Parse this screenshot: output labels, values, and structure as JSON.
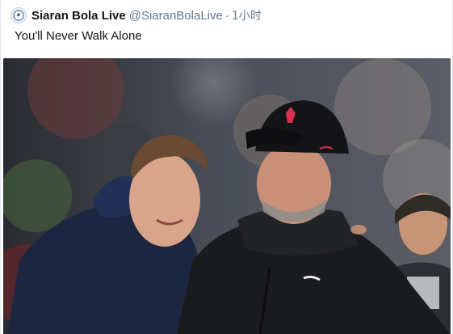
{
  "tweet": {
    "display_name": "Siaran Bola Live",
    "handle": "@SiaranBolaLive",
    "separator": "·",
    "time": "1小时",
    "text": "You'll Never Walk Alone",
    "avatar_icon": "soccer-ball-icon"
  },
  "media": {
    "description_icon": "photo",
    "colors": {
      "crowd_dark": "#2b2d33",
      "jacket_navy": "#1c2640",
      "jacket_black": "#1a1b1e",
      "cap_black": "#141416",
      "cap_logo": "#d6304a",
      "skin": "#d9a58a"
    }
  }
}
